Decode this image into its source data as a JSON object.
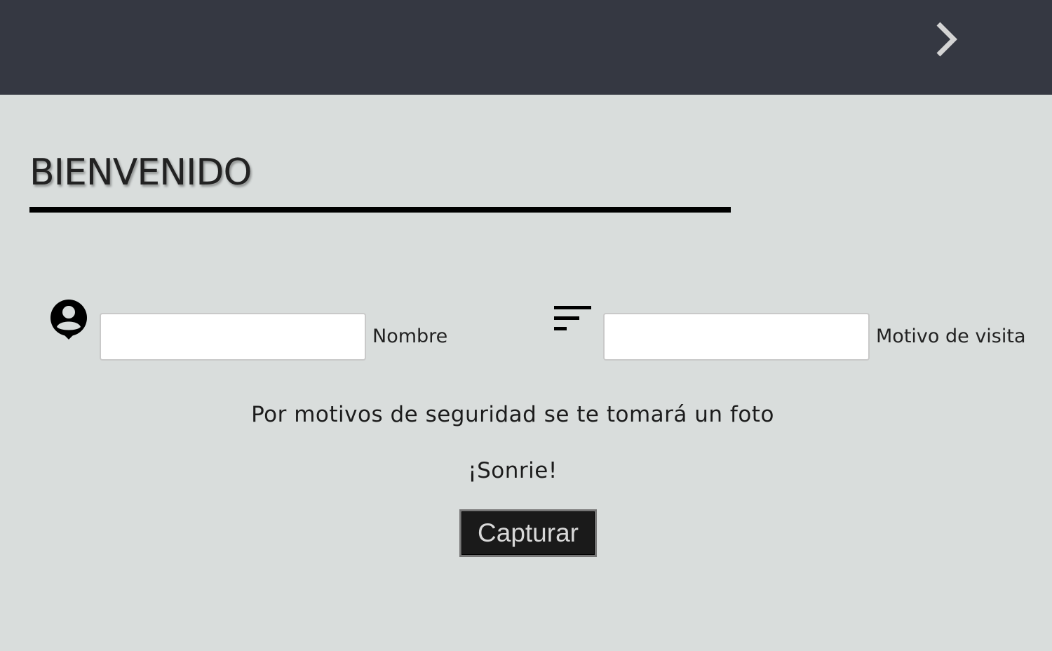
{
  "header": {
    "next_icon": "chevron-right-icon"
  },
  "main": {
    "title": "BIENVENIDO"
  },
  "form": {
    "nombre": {
      "icon": "account-circle-icon",
      "value": "",
      "label": "Nombre"
    },
    "motivo": {
      "icon": "sort-icon",
      "value": "",
      "label": "Motivo de visita"
    }
  },
  "messages": {
    "security": "Por motivos de seguridad se te tomará un foto",
    "smile": "¡Sonrie!"
  },
  "actions": {
    "capture_label": "Capturar"
  },
  "colors": {
    "header_bg": "#353842",
    "page_bg": "#d9dddc",
    "button_bg": "#1a1a1a"
  }
}
